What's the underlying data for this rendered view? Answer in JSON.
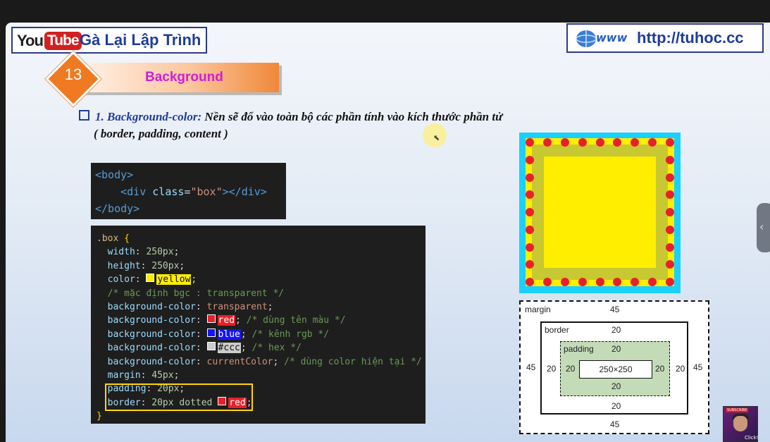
{
  "header": {
    "youtube_you": "You",
    "youtube_tube": "Tube",
    "channel_name": "Gà Lại Lập Trình",
    "website": "http://tuhoc.cc"
  },
  "lesson": {
    "number": "13",
    "title": "Background"
  },
  "heading": {
    "term": "1. Background-color:",
    "text": " Nền sẽ đổ vào toàn bộ các phần tính vào kích thước phần tử",
    "line2": "( border, padding, content )"
  },
  "html_code": {
    "line1": "<body>",
    "line2_open": "<div ",
    "line2_attr": "class",
    "line2_eq": "=",
    "line2_str": "\"box\"",
    "line2_close": "></div>",
    "line3": "</body>"
  },
  "css_code": {
    "selector": ".box ",
    "open_brace": "{",
    "close_brace": "}",
    "rules": [
      {
        "prop": "width",
        "sep": ": ",
        "val": "250px",
        "end": ";"
      },
      {
        "prop": "height",
        "sep": ": ",
        "val": "250px",
        "end": ";"
      },
      {
        "prop": "color",
        "sep": ": ",
        "val": "yellow",
        "end": ";"
      },
      {
        "comment": "/* mặc định bgc : transparent */"
      },
      {
        "prop": "background-color",
        "sep": ": ",
        "val": "transparent",
        "end": ";"
      },
      {
        "prop": "background-color",
        "sep": ": ",
        "val": "red",
        "end": ";",
        "comment": " /* dùng tên màu */"
      },
      {
        "prop": "background-color",
        "sep": ": ",
        "val": "blue",
        "end": ";",
        "comment": " /* kênh rgb */"
      },
      {
        "prop": "background-color",
        "sep": ": ",
        "val": "#ccc",
        "end": ";",
        "comment": " /* hex */"
      },
      {
        "prop": "background-color",
        "sep": ": ",
        "val": "currentColor",
        "end": ";",
        "comment": " /* dùng color hiện tại */"
      },
      {
        "prop": "margin",
        "sep": ": ",
        "val": "45px",
        "end": ";"
      },
      {
        "prop": "padding",
        "sep": ": ",
        "val": "20px",
        "end": ";"
      },
      {
        "prop": "border",
        "sep": ": ",
        "val": "20px dotted ",
        "val2": "red",
        "end": ";"
      }
    ]
  },
  "colors": {
    "yellow": "#ffee00",
    "red": "#e8202a",
    "blue": "#1414ff",
    "ccc": "#cccccc",
    "cyan": "#1ad0ff",
    "olive": "#c8c832"
  },
  "box_model": {
    "margin_label": "margin",
    "margin_top": "45",
    "margin_bottom": "45",
    "margin_left": "45",
    "margin_right": "45",
    "border_label": "border",
    "border_top": "20",
    "border_bottom": "20",
    "border_left": "20",
    "border_right": "20",
    "padding_label": "padding",
    "padding_top": "20",
    "padding_bottom": "20",
    "padding_left": "20",
    "padding_right": "20",
    "content": "250×250"
  },
  "avatar": {
    "subscribe": "SUBSCRIBE",
    "click": "Click!"
  }
}
